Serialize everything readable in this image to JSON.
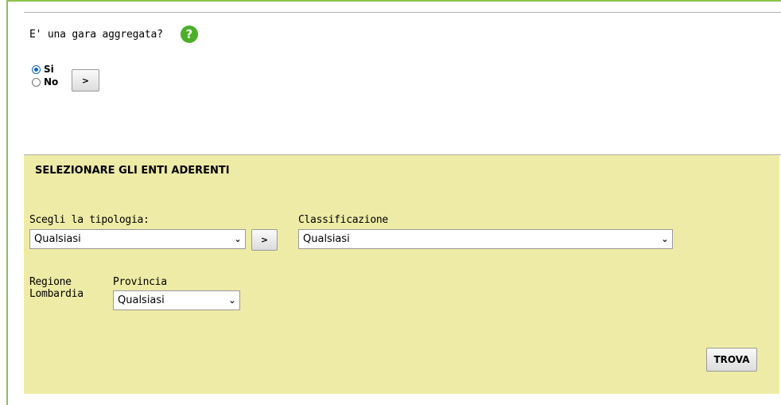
{
  "question": {
    "text": "E' una gara aggregata?",
    "help_icon": "help-circle-icon"
  },
  "aggregata": {
    "options": [
      {
        "label": "Si",
        "checked": true
      },
      {
        "label": "No",
        "checked": false
      }
    ],
    "next_button": ">"
  },
  "enti": {
    "title": "SELEZIONARE GLI ENTI ADERENTI",
    "tipologia": {
      "label": "Scegli la tipologia:",
      "value": "Qualsiasi",
      "next_button": ">"
    },
    "classificazione": {
      "label": "Classificazione",
      "value": "Qualsiasi"
    },
    "regione": {
      "label_line1": "Regione",
      "label_line2": "Lombardia"
    },
    "provincia": {
      "label": "Provincia",
      "value": "Qualsiasi"
    },
    "find_button": "TROVA"
  },
  "colors": {
    "panel_bg": "#eeeba6",
    "frame": "#8bc34a",
    "help": "#4caf2a",
    "radio": "#1565c0"
  }
}
